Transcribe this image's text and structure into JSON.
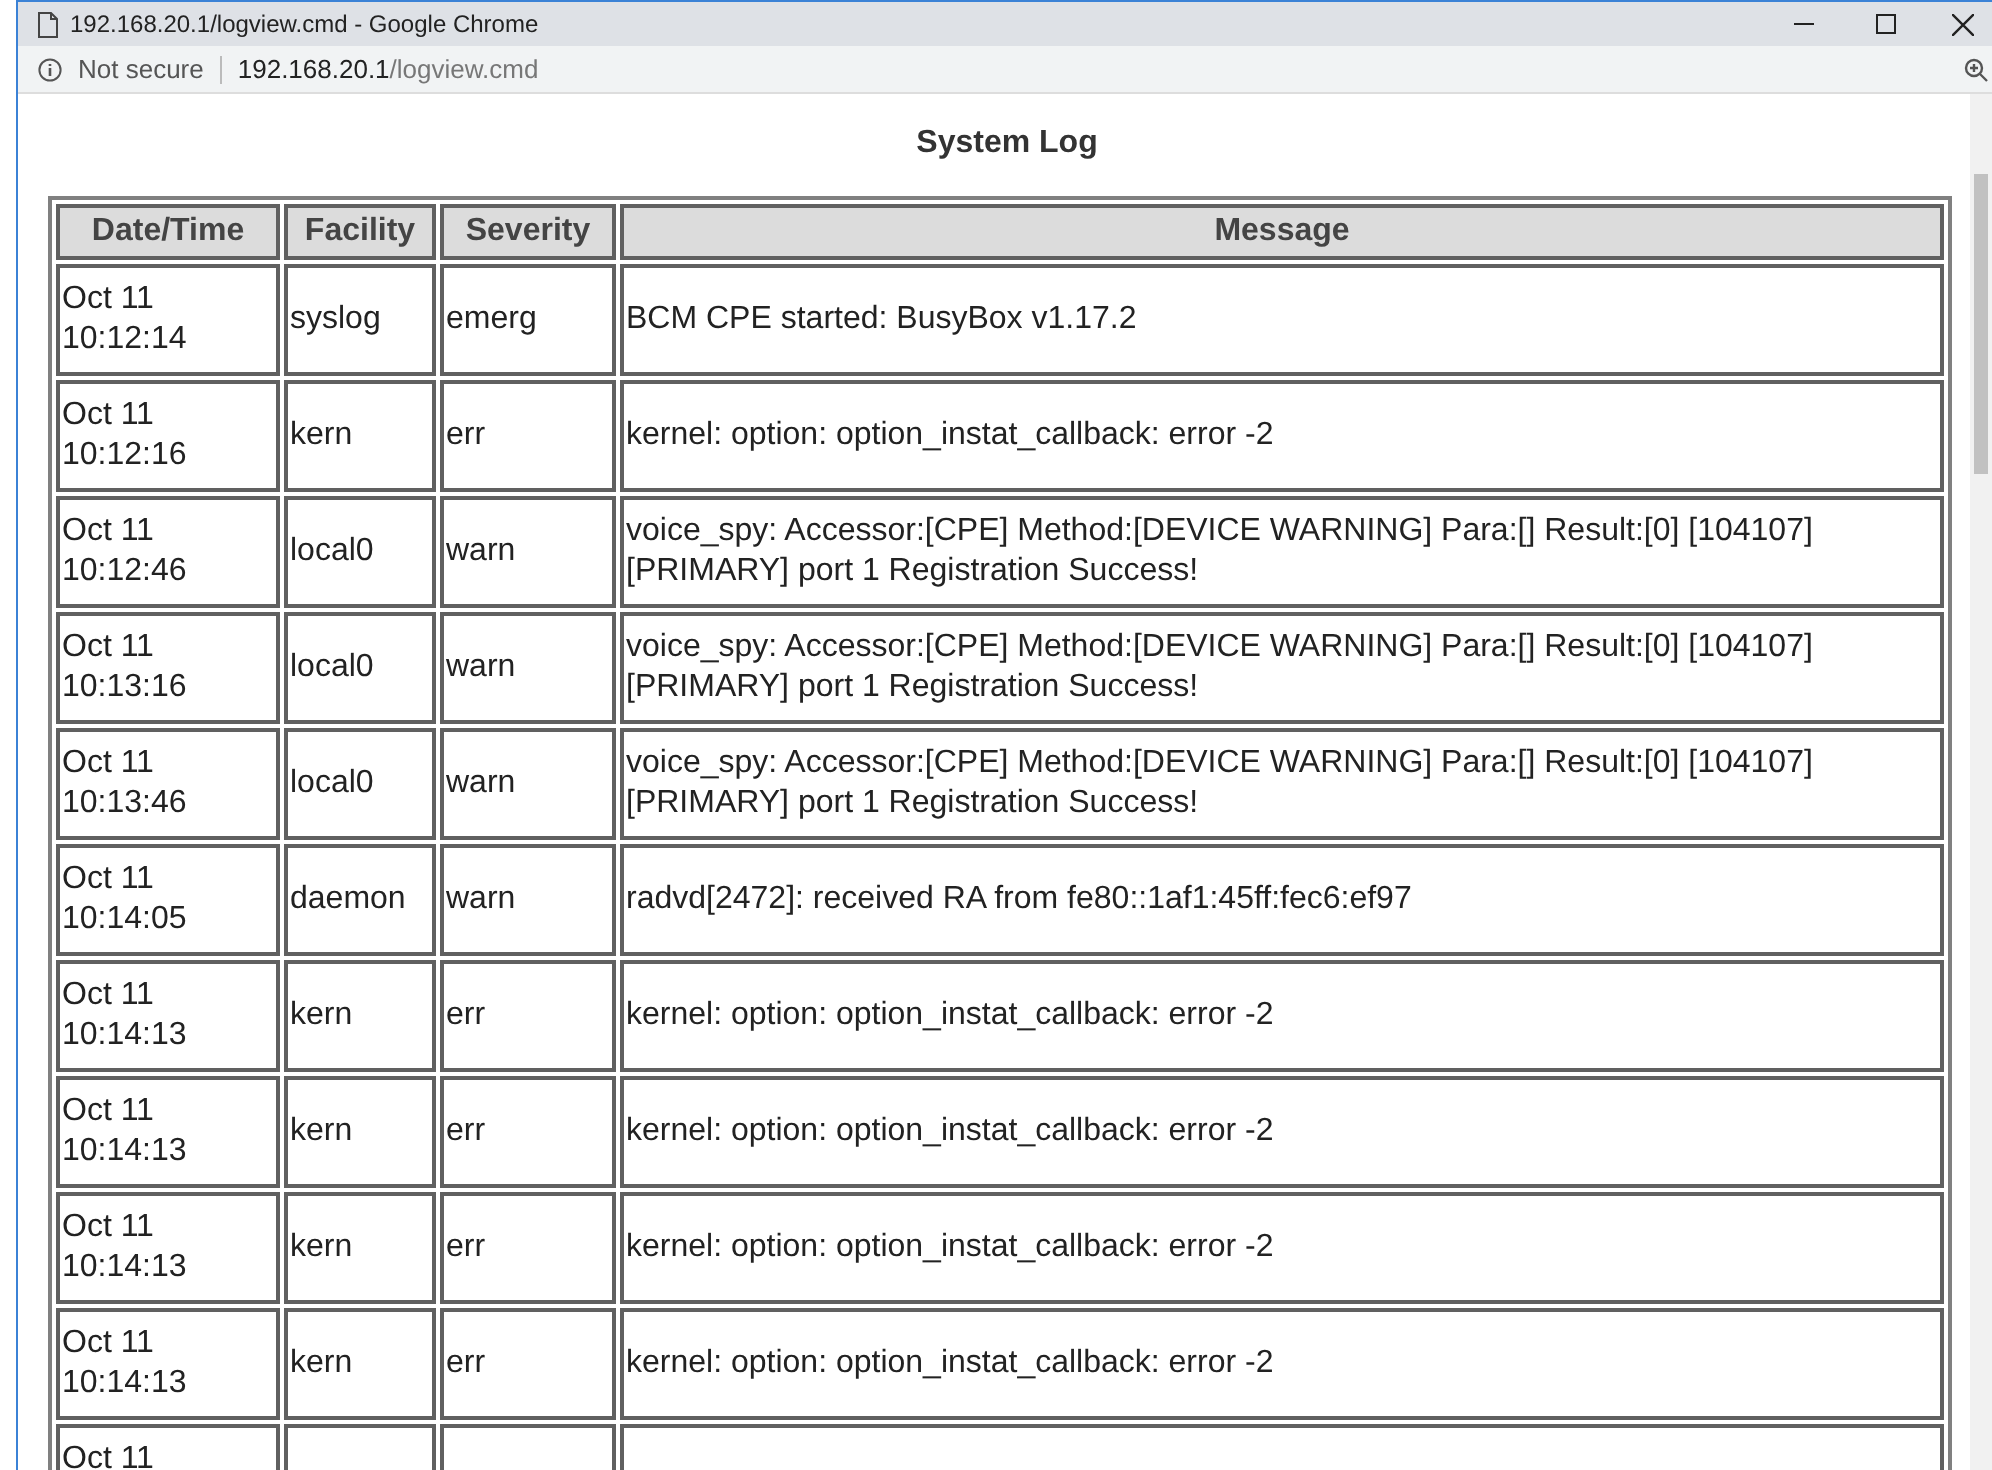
{
  "window": {
    "title": "192.168.20.1/logview.cmd - Google Chrome"
  },
  "address_bar": {
    "security": "Not secure",
    "host": "192.168.20.1",
    "path": "/logview.cmd"
  },
  "page": {
    "title": "System Log"
  },
  "table": {
    "columns": [
      "Date/Time",
      "Facility",
      "Severity",
      "Message"
    ],
    "rows": [
      {
        "date": "Oct 11",
        "time": "10:12:14",
        "facility": "syslog",
        "severity": "emerg",
        "message": "BCM CPE started: BusyBox v1.17.2"
      },
      {
        "date": "Oct 11",
        "time": "10:12:16",
        "facility": "kern",
        "severity": "err",
        "message": "kernel: option: option_instat_callback: error -2"
      },
      {
        "date": "Oct 11",
        "time": "10:12:46",
        "facility": "local0",
        "severity": "warn",
        "message": "voice_spy: Accessor:[CPE] Method:[DEVICE WARNING] Para:[] Result:[0] [104107][PRIMARY] port 1 Registration Success!"
      },
      {
        "date": "Oct 11",
        "time": "10:13:16",
        "facility": "local0",
        "severity": "warn",
        "message": "voice_spy: Accessor:[CPE] Method:[DEVICE WARNING] Para:[] Result:[0] [104107][PRIMARY] port 1 Registration Success!"
      },
      {
        "date": "Oct 11",
        "time": "10:13:46",
        "facility": "local0",
        "severity": "warn",
        "message": "voice_spy: Accessor:[CPE] Method:[DEVICE WARNING] Para:[] Result:[0] [104107][PRIMARY] port 1 Registration Success!"
      },
      {
        "date": "Oct 11",
        "time": "10:14:05",
        "facility": "daemon",
        "severity": "warn",
        "message": "radvd[2472]: received RA from fe80::1af1:45ff:fec6:ef97"
      },
      {
        "date": "Oct 11",
        "time": "10:14:13",
        "facility": "kern",
        "severity": "err",
        "message": "kernel: option: option_instat_callback: error -2"
      },
      {
        "date": "Oct 11",
        "time": "10:14:13",
        "facility": "kern",
        "severity": "err",
        "message": "kernel: option: option_instat_callback: error -2"
      },
      {
        "date": "Oct 11",
        "time": "10:14:13",
        "facility": "kern",
        "severity": "err",
        "message": "kernel: option: option_instat_callback: error -2"
      },
      {
        "date": "Oct 11",
        "time": "10:14:13",
        "facility": "kern",
        "severity": "err",
        "message": "kernel: option: option_instat_callback: error -2"
      },
      {
        "date": "Oct 11"
      }
    ]
  }
}
